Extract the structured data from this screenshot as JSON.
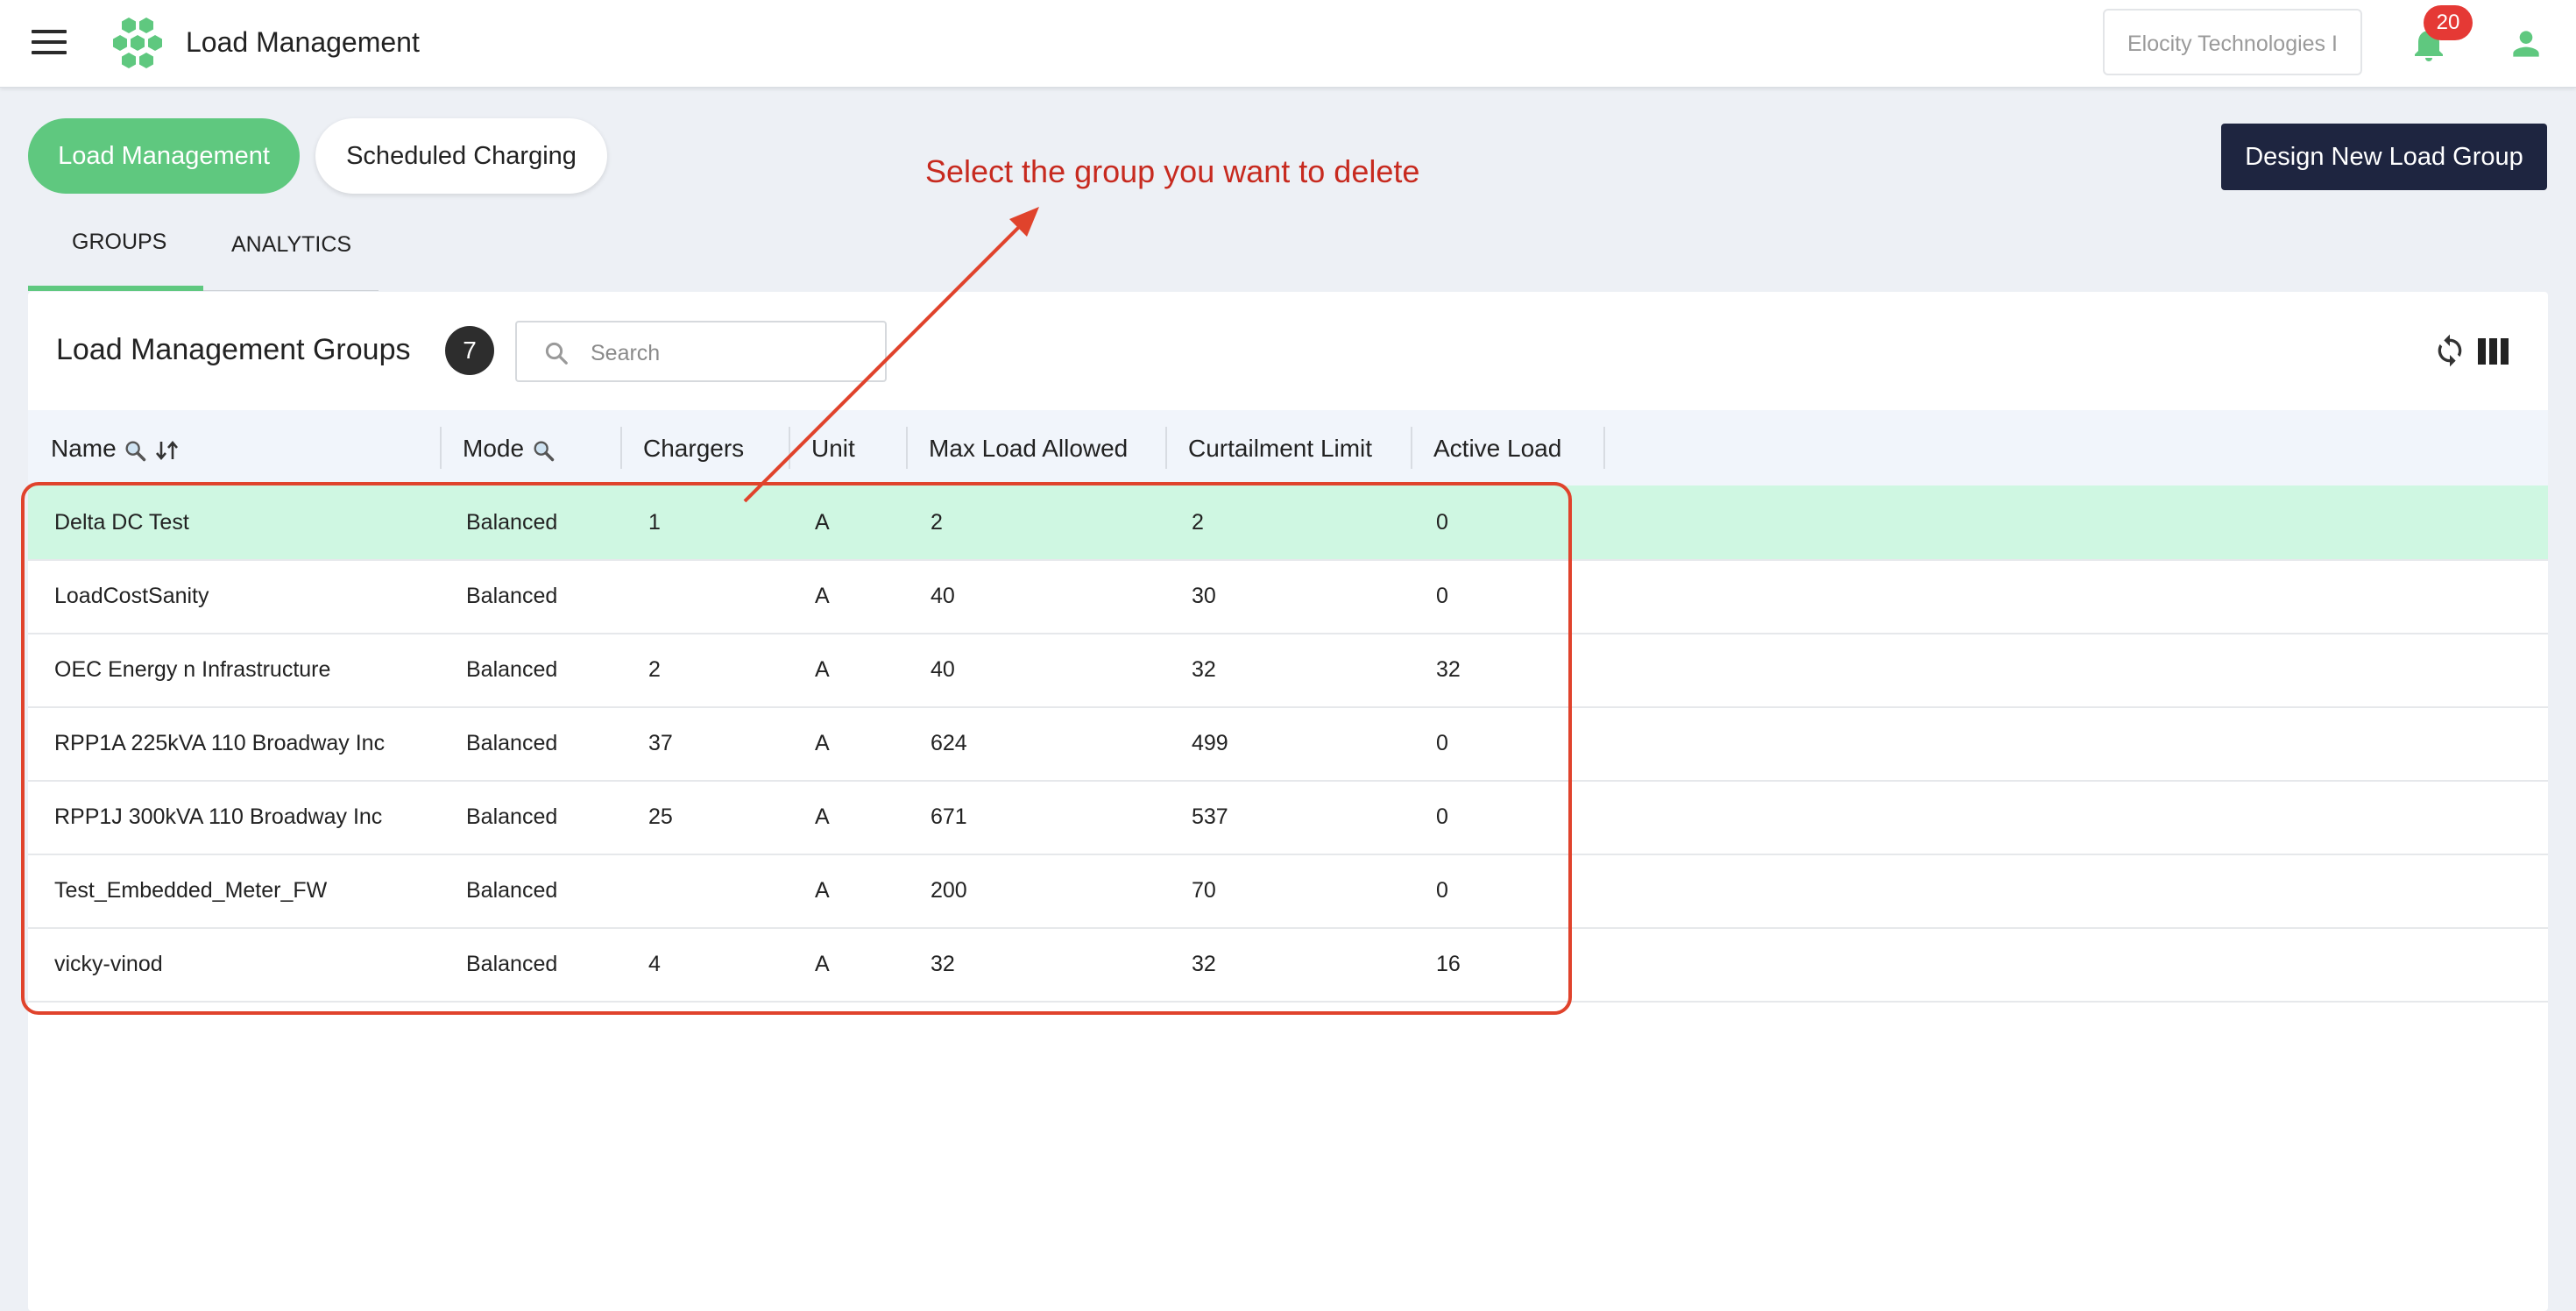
{
  "header": {
    "app_title": "Load Management",
    "org_selector_value": "Elocity Technologies I",
    "notification_count": "20"
  },
  "top_tabs": {
    "load_management": "Load Management",
    "scheduled_charging": "Scheduled Charging"
  },
  "design_button": "Design New Load Group",
  "annotation": "Select the group you want to delete",
  "sub_tabs": {
    "groups": "GROUPS",
    "analytics": "ANALYTICS"
  },
  "panel": {
    "title": "Load Management Groups",
    "count": "7",
    "search_placeholder": "Search"
  },
  "table": {
    "columns": [
      "Name",
      "Mode",
      "Chargers",
      "Unit",
      "Max Load Allowed",
      "Curtailment Limit",
      "Active Load"
    ],
    "rows": [
      {
        "name": "Delta DC Test",
        "mode": "Balanced",
        "chargers": "1",
        "unit": "A",
        "max_load": "2",
        "curtailment": "2",
        "active_load": "0"
      },
      {
        "name": "LoadCostSanity",
        "mode": "Balanced",
        "chargers": "",
        "unit": "A",
        "max_load": "40",
        "curtailment": "30",
        "active_load": "0"
      },
      {
        "name": "OEC Energy n Infrastructure",
        "mode": "Balanced",
        "chargers": "2",
        "unit": "A",
        "max_load": "40",
        "curtailment": "32",
        "active_load": "32"
      },
      {
        "name": "RPP1A 225kVA 110 Broadway Inc",
        "mode": "Balanced",
        "chargers": "37",
        "unit": "A",
        "max_load": "624",
        "curtailment": "499",
        "active_load": "0"
      },
      {
        "name": "RPP1J 300kVA 110 Broadway Inc",
        "mode": "Balanced",
        "chargers": "25",
        "unit": "A",
        "max_load": "671",
        "curtailment": "537",
        "active_load": "0"
      },
      {
        "name": "Test_Embedded_Meter_FW",
        "mode": "Balanced",
        "chargers": "",
        "unit": "A",
        "max_load": "200",
        "curtailment": "70",
        "active_load": "0"
      },
      {
        "name": "vicky-vinod",
        "mode": "Balanced",
        "chargers": "4",
        "unit": "A",
        "max_load": "32",
        "curtailment": "32",
        "active_load": "16"
      }
    ]
  },
  "colors": {
    "accent_green": "#5fc87f",
    "selected_row": "#cff7e2",
    "design_button_bg": "#1e2540",
    "annotation_red": "#c72a1f",
    "badge_red": "#e53935"
  },
  "icons": [
    "hamburger-menu-icon",
    "hexagon-logo-icon",
    "bell-icon",
    "user-icon",
    "search-icon",
    "refresh-icon",
    "columns-icon",
    "magnifier-icon",
    "sort-icon"
  ]
}
